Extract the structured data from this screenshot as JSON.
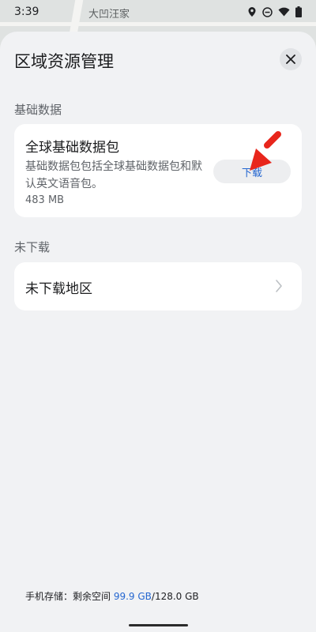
{
  "status": {
    "time": "3:39",
    "map_label": "大凹汪家"
  },
  "sheet": {
    "title": "区域资源管理",
    "close_icon": "close-icon"
  },
  "basic": {
    "section_label": "基础数据",
    "package_title": "全球基础数据包",
    "package_desc": "基础数据包包括全球基础数据包和默认英文语音包。",
    "package_size": "483 MB",
    "download_label": "下载"
  },
  "not_downloaded": {
    "section_label": "未下载",
    "region_label": "未下载地区"
  },
  "storage": {
    "prefix": "手机存储：剩余空间 ",
    "free": "99.9 GB",
    "total": "/128.0 GB"
  },
  "colors": {
    "accent": "#2466d0",
    "arrow": "#e8261c",
    "sheet_bg": "#f1f2f4"
  }
}
